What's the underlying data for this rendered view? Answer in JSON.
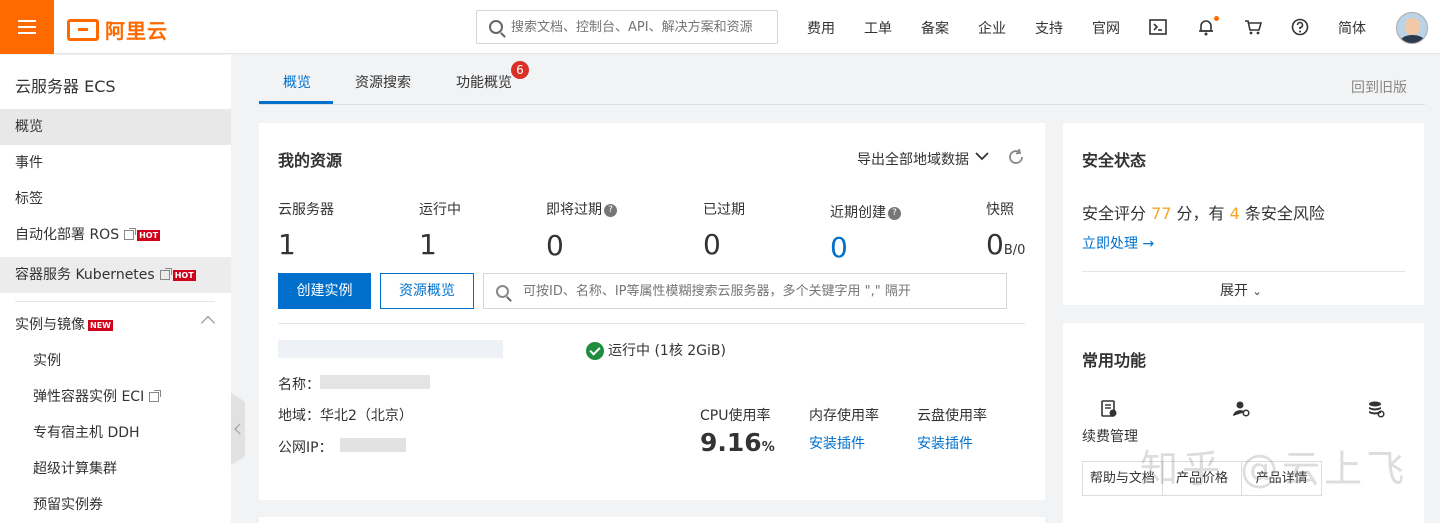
{
  "header": {
    "logo_text": "阿里云",
    "search_placeholder": "搜索文档、控制台、API、解决方案和资源",
    "nav": [
      "费用",
      "工单",
      "备案",
      "企业",
      "支持",
      "官网"
    ],
    "lang": "简体",
    "icons": [
      "terminal-icon",
      "bell-icon",
      "cart-icon",
      "help-icon"
    ]
  },
  "sidebar": {
    "title": "云服务器 ECS",
    "items": [
      {
        "label": "概览"
      },
      {
        "label": "事件"
      },
      {
        "label": "标签"
      },
      {
        "label": "自动化部署 ROS",
        "tag": "HOT"
      },
      {
        "label": "容器服务 Kubernetes",
        "tag": "HOT"
      }
    ],
    "group": {
      "label": "实例与镜像",
      "tag": "NEW"
    },
    "sub_items": [
      "实例",
      "弹性容器实例 ECI",
      "专有宿主机 DDH",
      "超级计算集群",
      "预留实例券"
    ]
  },
  "tabs": {
    "items": [
      "概览",
      "资源搜索",
      "功能概览"
    ],
    "badge": "6",
    "old_version": "回到旧版"
  },
  "resources": {
    "title": "我的资源",
    "export": "导出全部地域数据",
    "stats": [
      {
        "label": "云服务器",
        "value": "1"
      },
      {
        "label": "运行中",
        "value": "1"
      },
      {
        "label": "即将过期",
        "value": "0"
      },
      {
        "label": "已过期",
        "value": "0"
      },
      {
        "label": "近期创建",
        "value": "0"
      },
      {
        "label": "快照",
        "value": "0",
        "suffix": "B/0"
      }
    ],
    "create_button": "创建实例",
    "overview_button": "资源概览",
    "search_placeholder": "可按ID、名称、IP等属性模糊搜索云服务器，多个关键字用 \",\" 隔开",
    "instance": {
      "status": "运行中",
      "spec": "(1核 2GiB)",
      "name_label": "名称：",
      "region": "地域：华北2（北京）",
      "ip_label": "公网IP：",
      "cpu_label": "CPU使用率",
      "cpu_value": "9.16",
      "cpu_unit": "%",
      "mem_label": "内存使用率",
      "mem_value": "安装插件",
      "disk_label": "云盘使用率",
      "disk_value": "安装插件"
    }
  },
  "security": {
    "title": "安全状态",
    "score_prefix": "安全评分 ",
    "score": "77",
    "score_mid": " 分，有 ",
    "risks": "4",
    "score_suffix": " 条安全风险",
    "action": "立即处理 →",
    "expand": "展开"
  },
  "common": {
    "title": "常用功能",
    "renew": "续费管理",
    "tabs": [
      "帮助与文档",
      "产品价格",
      "产品详情"
    ]
  },
  "watermark": "知乎 @云上飞",
  "colors": {
    "brand": "#ff6a00",
    "primary": "#0070cc",
    "warning": "#f5a623",
    "success": "#1e8e3e"
  }
}
